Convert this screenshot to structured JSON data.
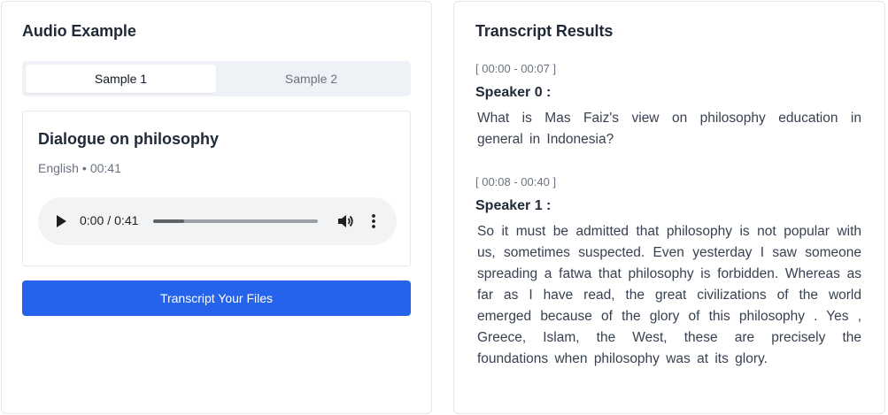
{
  "left_panel": {
    "title": "Audio Example",
    "tabs": [
      {
        "label": "Sample 1",
        "active": true
      },
      {
        "label": "Sample 2",
        "active": false
      }
    ],
    "sample": {
      "title": "Dialogue on philosophy",
      "language": "English",
      "separator": "•",
      "duration": "00:41"
    },
    "player": {
      "current_time": "0:00",
      "divider": "/",
      "total_time": "0:41",
      "progress": 0.19,
      "icons": [
        "play-icon",
        "volume-icon",
        "more-vert-icon"
      ]
    },
    "cta_label": "Transcript Your Files"
  },
  "right_panel": {
    "title": "Transcript Results",
    "segments": [
      {
        "time": "[ 00:00 - 00:07 ]",
        "speaker": "Speaker 0 :",
        "text": "What is Mas Faiz's view on philosophy education in general in Indonesia?"
      },
      {
        "time": "[ 00:08 - 00:40 ]",
        "speaker": "Speaker 1 :",
        "text": "So it must be admitted that philosophy is not popular with us, sometimes suspected. Even yesterday I saw someone spreading a fatwa that philosophy is forbidden. Whereas as far as I have read, the great civilizations of the world emerged because of the glory of this philosophy . Yes , Greece, Islam, the West, these are precisely the foundations when philosophy was at its glory."
      }
    ]
  },
  "colors": {
    "accent": "#2563eb",
    "tab_bg": "#eef2f6",
    "player_bg": "#f1f3f4",
    "muted_text": "#6b7280"
  }
}
